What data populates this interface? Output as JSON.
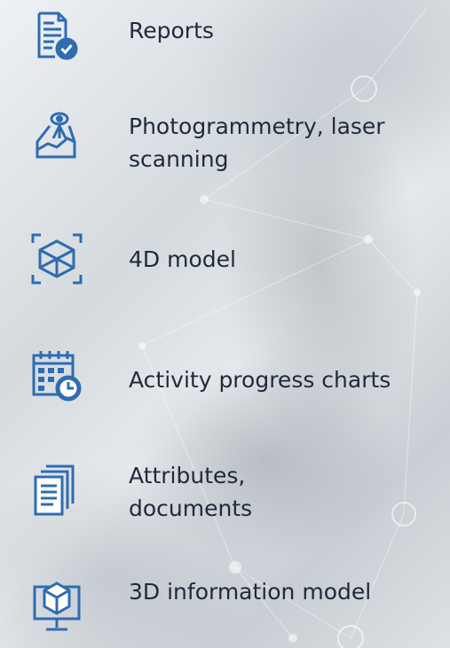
{
  "icon_color": "#2f6cb0",
  "items": [
    {
      "icon": "report-check-icon",
      "label": "Reports"
    },
    {
      "icon": "surveyor-map-icon",
      "label": "Photogrammetry, laser\nscanning"
    },
    {
      "icon": "cube-frame-icon",
      "label": "4D model"
    },
    {
      "icon": "calendar-clock-icon",
      "label": "Activity progress charts"
    },
    {
      "icon": "documents-icon",
      "label": "Attributes,\ndocuments"
    },
    {
      "icon": "monitor-cube-icon",
      "label": "3D information model"
    }
  ]
}
